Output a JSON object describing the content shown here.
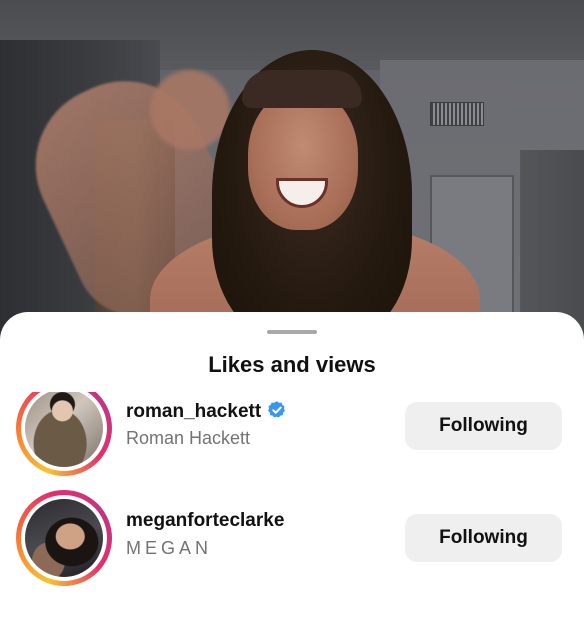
{
  "sheet": {
    "title": "Likes and views"
  },
  "users": [
    {
      "username": "roman_hackett",
      "full_name": "Roman Hackett",
      "verified": true,
      "follow_button_label": "Following",
      "avatar_ring": "story-gradient"
    },
    {
      "username": "meganforteclarke",
      "full_name": "MEGAN",
      "verified": false,
      "follow_button_label": "Following",
      "avatar_ring": "story-gradient"
    }
  ],
  "icons": {
    "verified": "verified-badge-icon",
    "grabber": "drag-handle"
  },
  "colors": {
    "verified_blue": "#3897f0",
    "button_bg": "#efefef",
    "secondary_text": "#737373",
    "primary_text": "#111111"
  }
}
